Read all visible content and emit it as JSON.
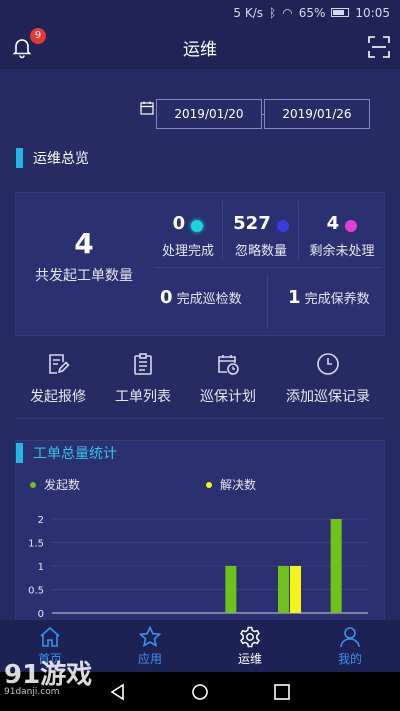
{
  "status_bar": {
    "speed": "5 K/s",
    "battery": "65%",
    "time": "10:05"
  },
  "app_bar": {
    "title": "运维",
    "notification_count": "9"
  },
  "date_range": {
    "start": "2019/01/20",
    "end": "2019/01/26"
  },
  "overview": {
    "title": "运维总览",
    "total": {
      "value": "4",
      "label": "共发起工单数量"
    },
    "stats": [
      {
        "value": "0",
        "label": "处理完成",
        "color": "#19d4e0"
      },
      {
        "value": "527",
        "label": "忽略数量",
        "color": "#3a3be0"
      },
      {
        "value": "4",
        "label": "剩余未处理",
        "color": "#e33ed7"
      }
    ],
    "patrol": {
      "value": "0",
      "label": "完成巡检数"
    },
    "maintenance": {
      "value": "1",
      "label": "完成保养数"
    }
  },
  "quick_actions": [
    {
      "label": "发起报修",
      "icon": "edit-doc-icon"
    },
    {
      "label": "工单列表",
      "icon": "clipboard-icon"
    },
    {
      "label": "巡保计划",
      "icon": "calendar-clock-icon"
    },
    {
      "label": "添加巡保记录",
      "icon": "clock-icon"
    }
  ],
  "chart_section": {
    "title": "工单总量统计"
  },
  "chart_data": {
    "type": "bar",
    "series": [
      {
        "name": "发起数",
        "color": "#6fc21c",
        "values": [
          0,
          0,
          0,
          1,
          1,
          2
        ]
      },
      {
        "name": "解决数",
        "color": "#f4f41c",
        "values": [
          0,
          0,
          0,
          0,
          1,
          0
        ]
      }
    ],
    "y_ticks": [
      "0",
      "0.5",
      "1",
      "1.5",
      "2"
    ],
    "ylim": [
      0,
      2
    ]
  },
  "bottom_nav": [
    {
      "label": "首页",
      "icon": "home-icon",
      "active": false
    },
    {
      "label": "应用",
      "icon": "star-icon",
      "active": false
    },
    {
      "label": "运维",
      "icon": "gear-icon",
      "active": true
    },
    {
      "label": "我的",
      "icon": "person-icon",
      "active": false
    }
  ],
  "watermark": {
    "brand": "91游戏",
    "site": "91danji.com"
  }
}
